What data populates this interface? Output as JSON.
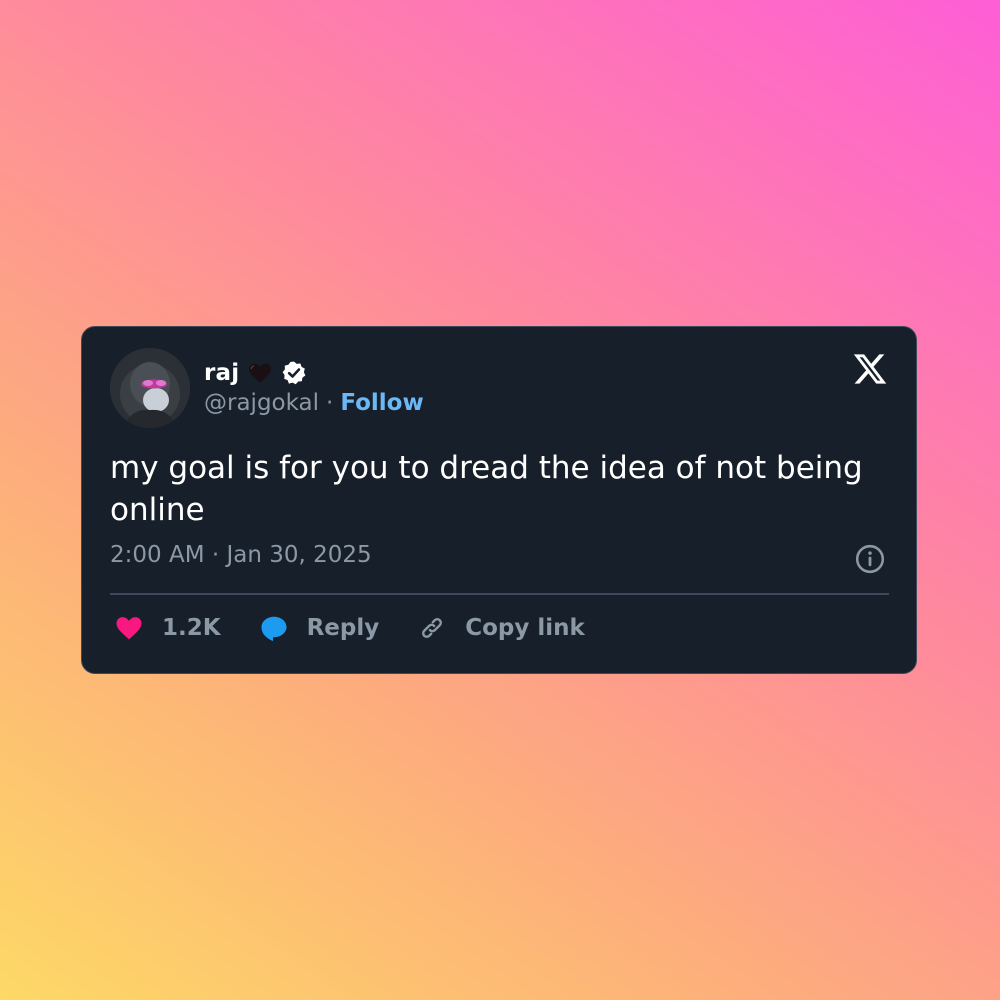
{
  "tweet": {
    "display_name": "raj",
    "handle": "@rajgokal",
    "separator": "·",
    "follow_label": "Follow",
    "text": "my goal is for you to dread the idea of not being online",
    "timestamp": "2:00 AM · Jan 30, 2025",
    "likes_count": "1.2K",
    "reply_label": "Reply",
    "copy_link_label": "Copy link",
    "icons": {
      "avatar": "ape-avatar",
      "name_emoji": "black-heart-icon",
      "badge": "verified-badge-icon",
      "platform": "x-logo-icon",
      "info": "info-icon",
      "like": "heart-icon",
      "reply": "speech-bubble-icon",
      "copy": "link-icon"
    }
  },
  "colors": {
    "card_background": "#17202a",
    "card_border": "#3d4a5c",
    "follow": "#6cb8f5",
    "secondary_text": "#8b98a5",
    "like": "#f91880",
    "reply": "#1d9bf0"
  }
}
